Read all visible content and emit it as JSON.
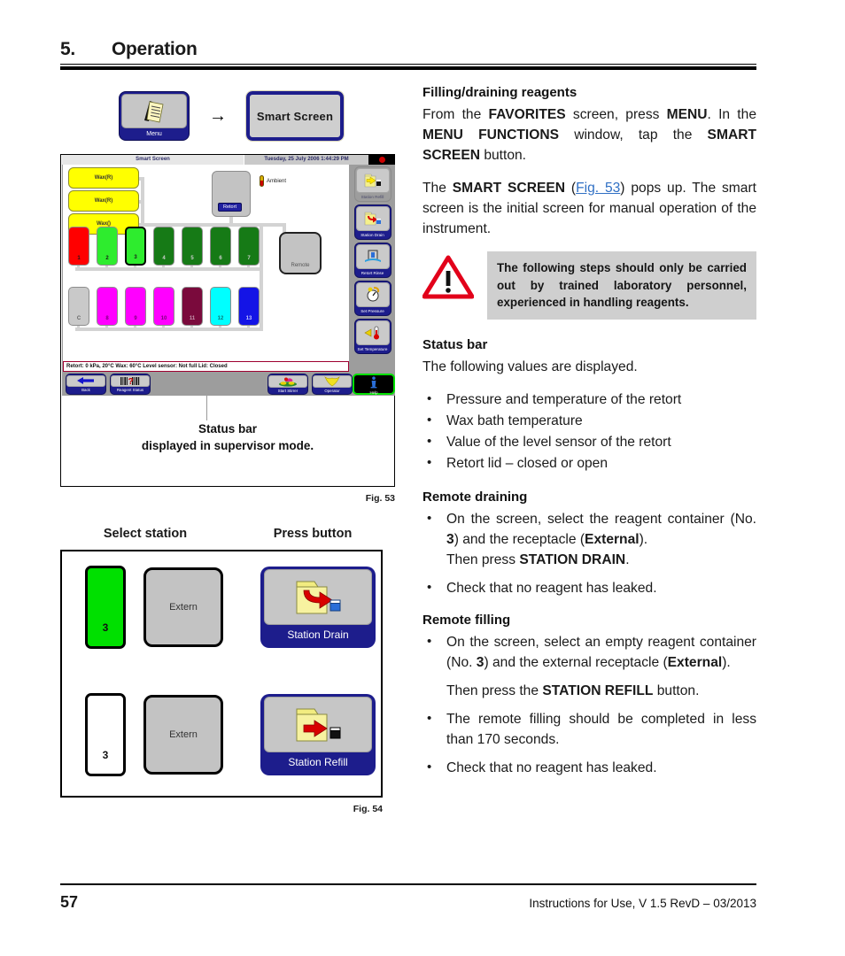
{
  "header": {
    "number": "5.",
    "title": "Operation"
  },
  "buttons_row": {
    "menu_label": "Menu",
    "arrow": "→",
    "smart_screen_label": "Smart Screen"
  },
  "fig53": {
    "screen_title": "Smart Screen",
    "screen_date": "Tuesday, 25 July 2006 1:44:29 PM",
    "wax": [
      {
        "label": "Wax(R)"
      },
      {
        "label": "Wax(R)"
      },
      {
        "label": "Wax()"
      }
    ],
    "retort_label": "Retort",
    "ambient_label": "Ambient",
    "remote_label": "Remote",
    "stations_top": [
      {
        "id": "1",
        "color": "#ff0000",
        "selected": false
      },
      {
        "id": "2",
        "color": "#2eec2e",
        "selected": false
      },
      {
        "id": "3",
        "color": "#2eec2e",
        "selected": true
      },
      {
        "id": "4",
        "color": "#167a16",
        "selected": false
      },
      {
        "id": "5",
        "color": "#167a16",
        "selected": false
      },
      {
        "id": "6",
        "color": "#167a16",
        "selected": false
      },
      {
        "id": "7",
        "color": "#167a16",
        "selected": false
      }
    ],
    "stations_bottom": [
      {
        "id": "C",
        "color": "#c9c9c9",
        "selected": false
      },
      {
        "id": "8",
        "color": "#ff00ff",
        "selected": false
      },
      {
        "id": "9",
        "color": "#ff00ff",
        "selected": false
      },
      {
        "id": "10",
        "color": "#ff00ff",
        "selected": false
      },
      {
        "id": "11",
        "color": "#7a0a3c",
        "selected": false
      },
      {
        "id": "12",
        "color": "#00ffff",
        "selected": false
      },
      {
        "id": "13",
        "color": "#1414e6",
        "selected": false
      }
    ],
    "side_buttons": [
      {
        "label": "Station Refill",
        "icon": "station-refill-icon"
      },
      {
        "label": "Station Drain",
        "icon": "station-drain-icon"
      },
      {
        "label": "Retort Rinse",
        "icon": "retort-rinse-icon"
      },
      {
        "label": "Set Pressure",
        "icon": "set-pressure-icon"
      },
      {
        "label": "Set Temperature",
        "icon": "set-temperature-icon"
      }
    ],
    "bottom_buttons": [
      {
        "label": "Back",
        "icon": "back-arrow-icon"
      },
      {
        "label": "Reagent Status",
        "icon": "barcode-question-icon"
      },
      {
        "label": "Start Stirrer",
        "icon": "stirrer-icon"
      },
      {
        "label": "Operator",
        "icon": "operator-icon"
      },
      {
        "label": "Help",
        "icon": "info-icon"
      }
    ],
    "status_bar_text": "Retort:   0 kPa,  20°C   Wax:  60°C   Level sensor: Not full   Lid: Closed",
    "callout_line1": "Status bar",
    "callout_line2": "displayed in supervisor mode.",
    "fig_number": "Fig. 53"
  },
  "fig54": {
    "head_select": "Select station",
    "head_press": "Press button",
    "rows": [
      {
        "vial_id": "3",
        "vial_color": "#00e000",
        "extern_label": "Extern",
        "button_label": "Station Drain",
        "button_icon": "station-drain-icon"
      },
      {
        "vial_id": "3",
        "vial_color": "#ffffff",
        "extern_label": "Extern",
        "button_label": "Station Refill",
        "button_icon": "station-refill-icon"
      }
    ],
    "fig_number": "Fig. 54"
  },
  "right": {
    "h_filling": "Filling/draining reagents",
    "p1_a": "From the ",
    "p1_b": "FAVORITES",
    "p1_c": " screen, press ",
    "p1_d": "MENU",
    "p1_e": ". In the ",
    "p1_f": "MENU FUNCTIONS",
    "p1_g": " window, tap the ",
    "p1_h": "SMART SCREEN",
    "p1_i": " button.",
    "p2_a": "The ",
    "p2_b": "SMART SCREEN",
    "p2_c": " (",
    "p2_ref": "Fig. 53",
    "p2_d": ") pops up. The smart screen is the initial screen for manual operation of the instrument.",
    "warning": "The following steps should only be carried out by trained laboratory personnel, experienced in handling reagents.",
    "h_status": "Status bar",
    "p_status": "The following values are displayed.",
    "status_items": [
      "Pressure and temperature of the retort",
      "Wax bath temperature",
      "Value of the level sensor of the retort",
      "Retort lid – closed or open"
    ],
    "h_remote_drain": "Remote draining",
    "rd_1_a": "On the screen, select the reagent container (No. ",
    "rd_1_b": "3",
    "rd_1_c": ") and the receptacle (",
    "rd_1_d": "External",
    "rd_1_e": ").",
    "rd_1_f": "Then press ",
    "rd_1_g": "STATION DRAIN",
    "rd_1_h": ".",
    "rd_2": "Check that no reagent has leaked.",
    "h_remote_fill": "Remote filling",
    "rf_1_a": "On the screen, select an empty reagent container (No. ",
    "rf_1_b": "3",
    "rf_1_c": ") and the external receptacle (",
    "rf_1_d": "External",
    "rf_1_e": ").",
    "rf_1_f": "Then press the ",
    "rf_1_g": "STATION REFILL",
    "rf_1_h": " button.",
    "rf_2": "The remote filling should be completed in less than 170 seconds.",
    "rf_3": "Check that no reagent has leaked."
  },
  "footer": {
    "page_number": "57",
    "text": "Instructions for Use, V 1.5 RevD – 03/2013"
  }
}
